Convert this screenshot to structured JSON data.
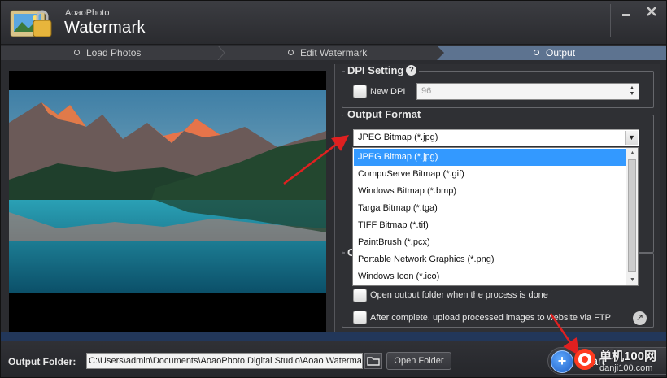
{
  "app": {
    "subtitle": "AoaoPhoto",
    "title": "Watermark"
  },
  "window_controls": {
    "minimize_icon": "minimize-icon",
    "close_icon": "close-icon"
  },
  "steps": [
    {
      "label": "Load Photos",
      "active": false
    },
    {
      "label": "Edit Watermark",
      "active": false
    },
    {
      "label": "Output",
      "active": true
    }
  ],
  "dpi": {
    "legend": "DPI Setting",
    "checkbox_label": "New DPI",
    "checked": false,
    "value": "96"
  },
  "output_format": {
    "legend": "Output Format",
    "selected": "JPEG Bitmap (*.jpg)",
    "options": [
      "JPEG Bitmap (*.jpg)",
      "CompuServe Bitmap (*.gif)",
      "Windows Bitmap (*.bmp)",
      "Targa Bitmap (*.tga)",
      "TIFF Bitmap (*.tif)",
      "PaintBrush (*.pcx)",
      "Portable Network Graphics (*.png)",
      "Windows Icon (*.ico)"
    ]
  },
  "options": {
    "open_folder_label": "Open output folder when the process is done",
    "upload_label": "After complete, upload processed images to website via FTP"
  },
  "bottom": {
    "output_label": "Output Folder:",
    "path": "C:\\Users\\admin\\Documents\\AoaoPhoto Digital Studio\\Aoao Watermark",
    "open_button": "Open Folder",
    "start_label": "Start"
  },
  "site_watermark": {
    "text": "单机100网",
    "url": "danji100.com"
  },
  "colors": {
    "accent": "#5d7390",
    "highlight": "#3399ff",
    "arrow": "#e02020"
  }
}
